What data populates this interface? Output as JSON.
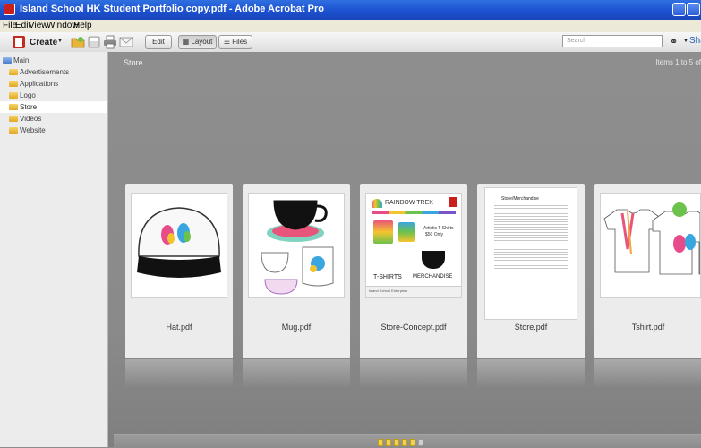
{
  "window": {
    "title": "Island School HK Student Portfolio copy.pdf - Adobe Acrobat Pro"
  },
  "menu": [
    "File",
    "Edit",
    "View",
    "Window",
    "Help"
  ],
  "toolbar": {
    "create_label": "Create",
    "edit_label": "Edit",
    "layout_label": "Layout",
    "files_label": "Files",
    "search_placeholder": "Search",
    "share_label": "Share"
  },
  "sidebar": {
    "root": "Main",
    "items": [
      "Advertisements",
      "Applications",
      "Logo",
      "Store",
      "Videos",
      "Website"
    ],
    "selected": "Store"
  },
  "main": {
    "section_title": "Store",
    "items_count": "Items 1 to 5 of",
    "files": [
      {
        "label": "Hat.pdf"
      },
      {
        "label": "Mug.pdf"
      },
      {
        "label": "Store-Concept.pdf"
      },
      {
        "label": "Store.pdf"
      },
      {
        "label": "Tshirt.pdf"
      }
    ]
  },
  "thumbnail_text": {
    "brand": "RAINBOW TREK",
    "tagline": "Artistic T-Shirts",
    "price": "$50 Only",
    "tshirts": "T-SHIRTS",
    "merchandise": "MERCHANDISE",
    "footer": "Island School Enterprise",
    "doc_heading": "Store/Merchandise"
  },
  "colors": {
    "titlebar": "#1b4fcf",
    "sidebar": "#ececec",
    "background": "#8d8d8d",
    "folder": "#e0a823"
  }
}
